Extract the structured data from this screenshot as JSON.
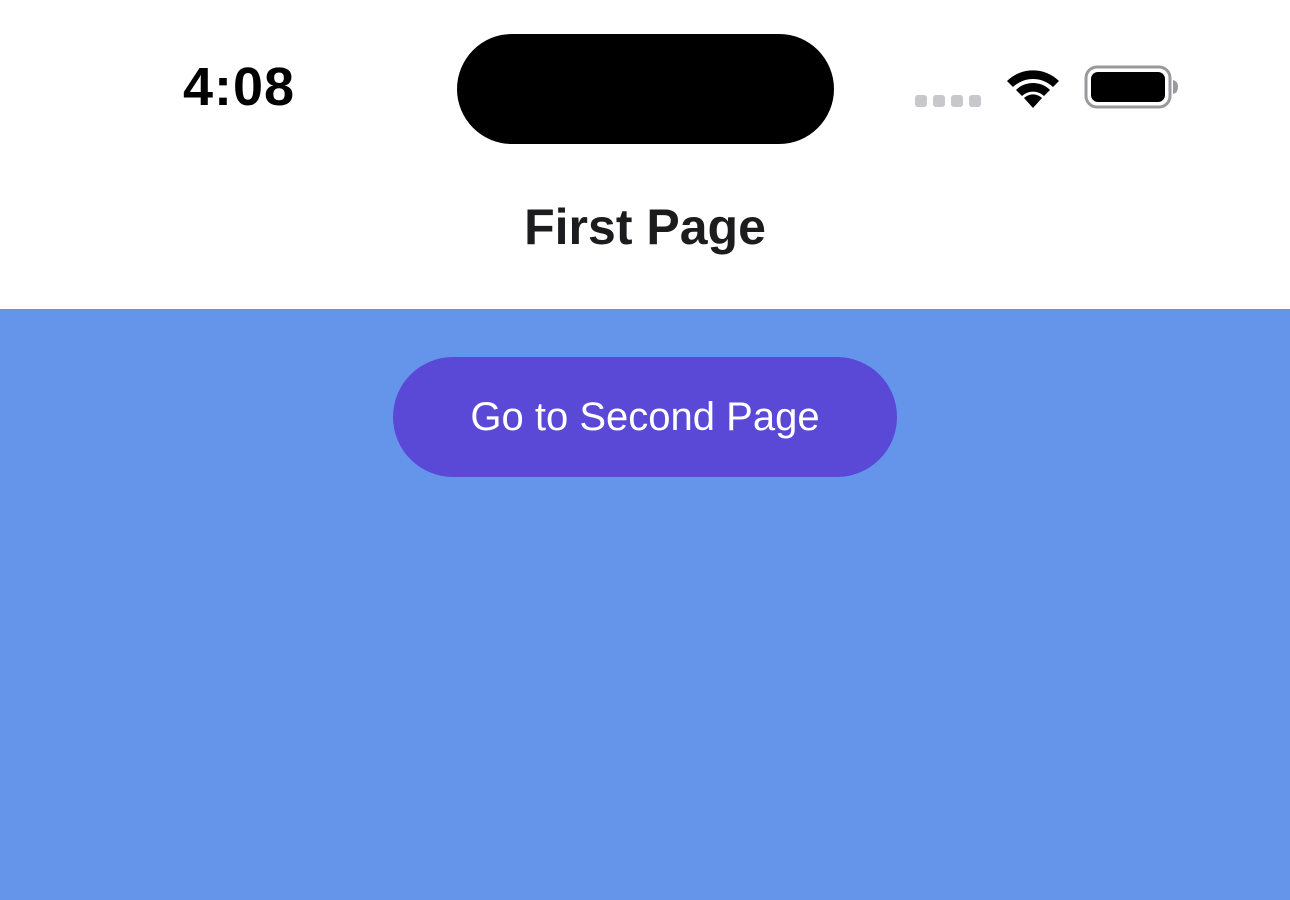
{
  "status_bar": {
    "time": "4:08",
    "signal_icon": "cellular-signal-icon",
    "wifi_icon": "wifi-icon",
    "battery_icon": "battery-icon",
    "battery_level": 1.0
  },
  "nav": {
    "title": "First Page"
  },
  "content": {
    "background_color": "#6495ea",
    "button": {
      "label": "Go to Second Page",
      "color": "#5a48d6",
      "text_color": "#ffffff"
    }
  }
}
